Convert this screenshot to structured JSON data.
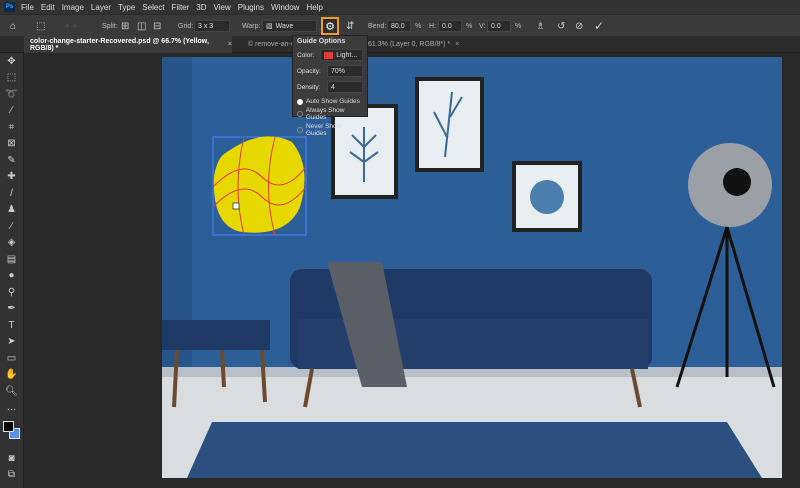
{
  "app": {
    "logo": "Ps"
  },
  "menu": [
    "File",
    "Edit",
    "Image",
    "Layer",
    "Type",
    "Select",
    "Filter",
    "3D",
    "View",
    "Plugins",
    "Window",
    "Help"
  ],
  "options": {
    "split_label": "Split:",
    "grid_label": "Grid:",
    "grid_value": "3 x 3",
    "warp_label": "Warp:",
    "warp_value": "Wave",
    "bend_label": "Bend:",
    "bend_value": "80.0",
    "h_label": "H:",
    "h_value": "0.0",
    "v_label": "V:",
    "v_value": "0.0",
    "percent": "%"
  },
  "tabs": [
    {
      "label": "color-change-starter-Recovered.psd @ 66.7% (Yellow, RGB/8) *",
      "active": true
    },
    {
      "label": "© remove-an-object-Recovered.jpg @ 61.3% (Layer 0, RGB/8*) *",
      "active": false
    }
  ],
  "guide_options": {
    "title": "Guide Options",
    "color_label": "Color:",
    "color_value": "Light...",
    "color_swatch": "#e63a3a",
    "opacity_label": "Opacity:",
    "opacity_value": "70%",
    "density_label": "Density:",
    "density_value": "4",
    "radios": [
      {
        "label": "Auto Show Guides",
        "checked": true
      },
      {
        "label": "Always Show Guides",
        "checked": false
      },
      {
        "label": "Never Show Guides",
        "checked": false
      }
    ]
  },
  "colors": {
    "accent": "#f0a020",
    "wall": "#2c5f98",
    "shape": "#e6d800"
  }
}
